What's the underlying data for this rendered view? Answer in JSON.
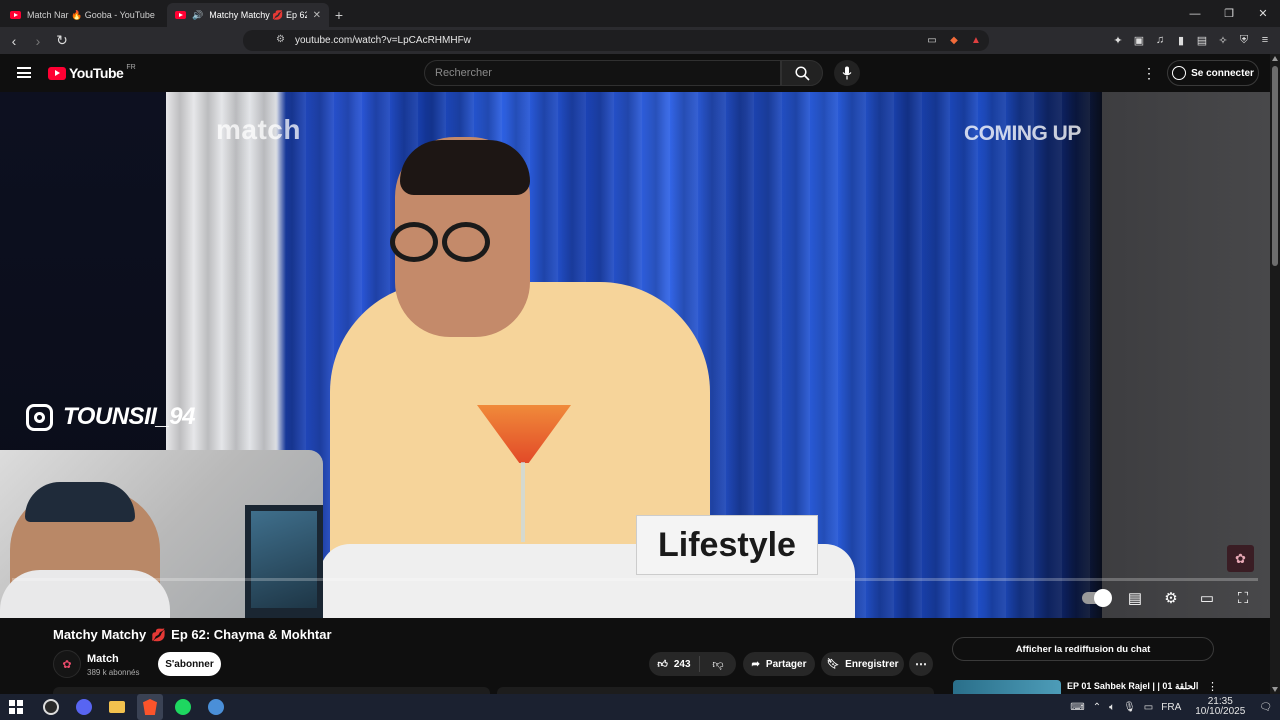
{
  "browser": {
    "tabs": [
      {
        "title": "Match Nar 🔥 Gooba - YouTube",
        "active": false
      },
      {
        "title": "Matchy Matchy 💋 Ep 62: Chayma & Mokhtar",
        "active": true
      }
    ],
    "new_tab": "+",
    "url": "youtube.com/watch?v=LpCAcRHMHFw",
    "window_controls": {
      "minimize": "—",
      "restore": "❐",
      "close": "✕"
    }
  },
  "youtube": {
    "logo_text": "YouTube",
    "region": "FR",
    "search": {
      "placeholder": "Rechercher",
      "value": ""
    },
    "signin_label": "Se connecter"
  },
  "video": {
    "overlays": {
      "brand": "match",
      "coming_up": "COMING UP",
      "instagram_handle": "TOUNSII_94",
      "name_card": "Lifestyle"
    },
    "progress_fraction": 0.0
  },
  "meta": {
    "title_prefix": "Matchy Matchy",
    "title_icon": "💋",
    "title_suffix": "Ep 62: Chayma & Mokhtar",
    "channel": {
      "name": "Match",
      "subscribers": "389 k abonnés"
    },
    "subscribe_label": "S'abonner",
    "likes": "243",
    "share_label": "Partager",
    "save_label": "Enregistrer",
    "more_label": "⋯"
  },
  "sidebar": {
    "chat_replay_label": "Afficher la rediffusion du chat",
    "recommendations": [
      {
        "title": "EP 01 Sahbek Rajel | | 01 الحلقة"
      }
    ]
  },
  "taskbar": {
    "language": "FRA",
    "time": "21:35",
    "date": "10/10/2025"
  },
  "colors": {
    "youtube_red": "#ff0033",
    "page_bg": "#0f0f0f",
    "pill_bg": "#272727"
  }
}
